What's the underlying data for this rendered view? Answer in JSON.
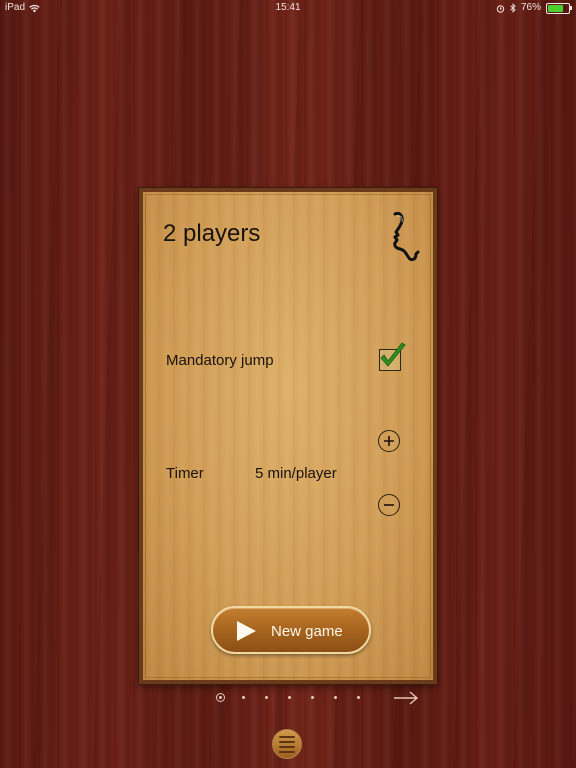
{
  "status_bar": {
    "device": "iPad",
    "wifi_icon": "wifi-icon",
    "time": "15:41",
    "alarm_icon": "alarm-icon",
    "bluetooth_icon": "bluetooth-icon",
    "battery_percent": "76%",
    "battery_level": 0.76
  },
  "card": {
    "title": "2 players",
    "player_icon": "profile-head-icon",
    "mandatory_jump": {
      "label": "Mandatory jump",
      "checked": true
    },
    "timer": {
      "label": "Timer",
      "value": "5 min/player",
      "increase_icon": "plus-icon",
      "decrease_icon": "minus-icon"
    },
    "new_game_button": {
      "label": "New game",
      "icon": "play-icon"
    }
  },
  "pager": {
    "total_pages": 7,
    "current_page": 1,
    "next_icon": "arrow-right-icon"
  },
  "menu_button": {
    "icon": "menu-icon"
  },
  "colors": {
    "card_border": "#6a3a1a",
    "check": "#2f8f1f",
    "button": "#a6641f"
  }
}
